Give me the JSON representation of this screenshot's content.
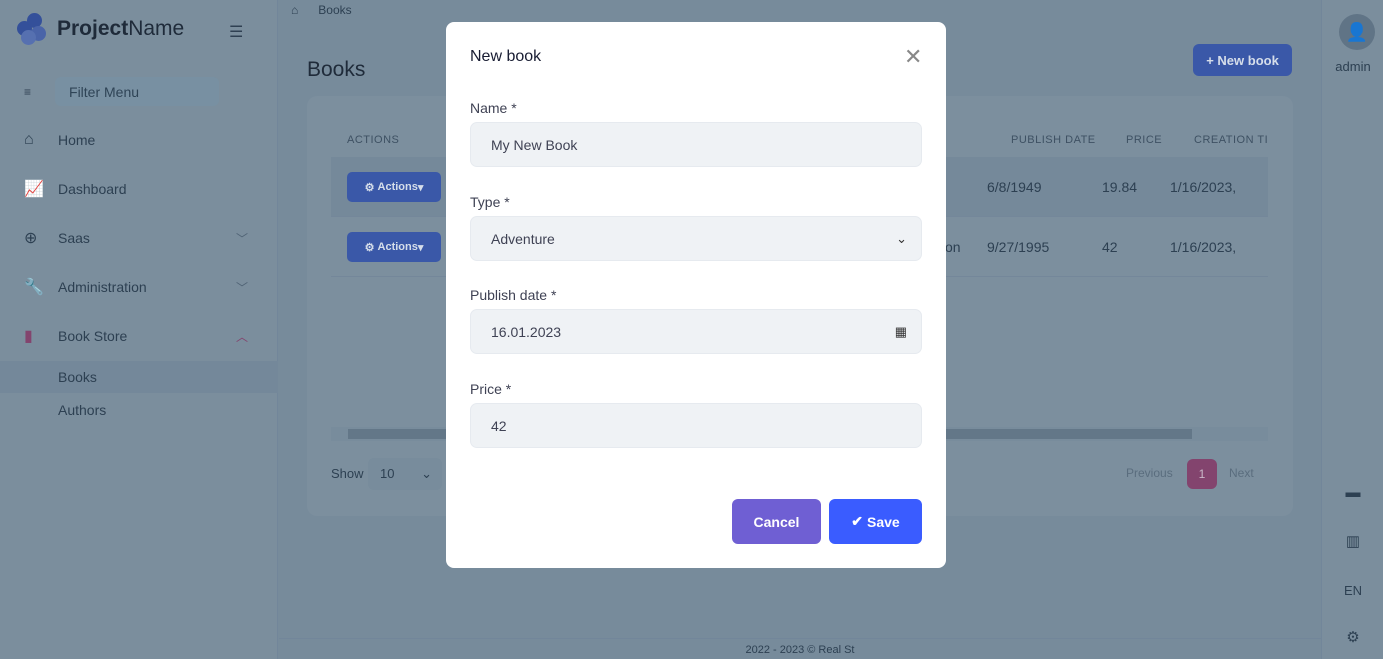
{
  "app": {
    "name_bold": "Project",
    "name_light": "Name"
  },
  "sidebar": {
    "filter_placeholder": "Filter Menu",
    "items": [
      {
        "label": "Home"
      },
      {
        "label": "Dashboard"
      },
      {
        "label": "Saas"
      },
      {
        "label": "Administration"
      },
      {
        "label": "Book Store"
      }
    ],
    "sub_items": [
      {
        "label": "Books"
      },
      {
        "label": "Authors"
      }
    ]
  },
  "breadcrumb": {
    "current": "Books"
  },
  "page": {
    "title": "Books",
    "new_button": "New book"
  },
  "table": {
    "headers": [
      "ACTIONS",
      "PUBLISH DATE",
      "PRICE",
      "CREATION TI"
    ],
    "action_label": "Actions",
    "rows": [
      {
        "type": "",
        "publish_date": "6/8/1949",
        "price": "19.84",
        "creation_time": "1/16/2023,"
      },
      {
        "type": "ction",
        "publish_date": "9/27/1995",
        "price": "42",
        "creation_time": "1/16/2023,"
      }
    ],
    "show_label": "Show",
    "page_size": "10",
    "previous": "Previous",
    "page": "1",
    "next": "Next"
  },
  "footer": {
    "text": "2022 - 2023 © Real St"
  },
  "user": {
    "name": "admin"
  },
  "right_bar": {
    "language": "EN"
  },
  "modal": {
    "title": "New book",
    "name_label": "Name *",
    "name_value": "My New Book",
    "type_label": "Type *",
    "type_value": "Adventure",
    "date_label": "Publish date *",
    "date_value": "16.01.2023",
    "price_label": "Price *",
    "price_value": "42",
    "cancel": "Cancel",
    "save": "Save"
  }
}
